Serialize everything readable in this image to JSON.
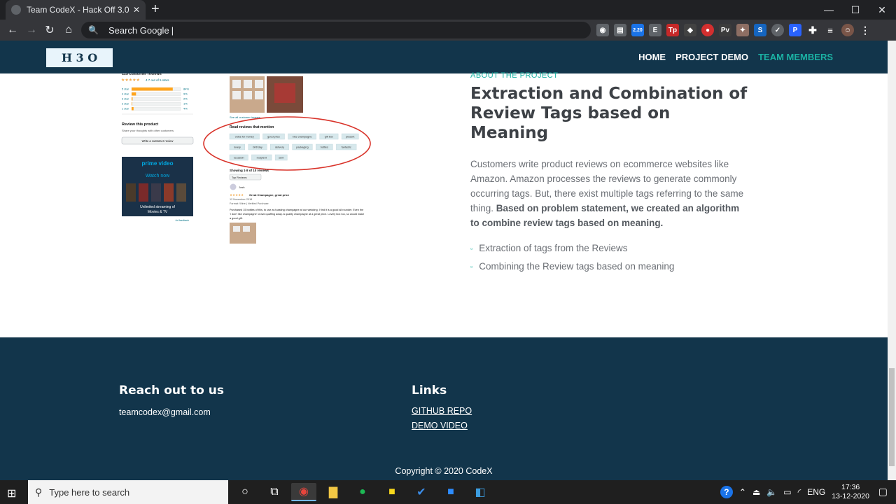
{
  "browser": {
    "tab_title": "Team CodeX - Hack Off 3.0",
    "omnibox_text": "Search Google",
    "badge_count": "2.20"
  },
  "site": {
    "logo_text": "H 3 O",
    "nav": [
      {
        "label": "HOME"
      },
      {
        "label": "PROJECT DEMO"
      },
      {
        "label": "TEAM MEMBERS"
      }
    ]
  },
  "about": {
    "kicker": "ABOUT THE PROJECT",
    "heading": "Extraction and Combination of Review Tags based on Meaning",
    "paragraph_plain": "Customers write product reviews on ecommerce websites like Amazon. Amazon processes the reviews to generate commonly occurring tags. But, there exist multiple tags referring to the same thing. ",
    "paragraph_bold": "Based on problem statement, we created an algorithm to combine review tags based on meaning.",
    "points": [
      "Extraction of tags from the Reviews",
      "Combining the Review tags based on meaning"
    ]
  },
  "screenshot": {
    "review_heading": "Review this product",
    "review_sub": "Share your thoughts with other customers",
    "write_review_btn": "Write a customer review",
    "prime_title": "prime video",
    "prime_cta": "Watch now",
    "prime_caption": "Unlimited streaming of Movies & TV",
    "tags_heading": "Read reviews that mention",
    "tags": [
      "value for money",
      "good price",
      "nice champagne",
      "gift box",
      "present",
      "lovely",
      "birthday",
      "delivery",
      "packaging",
      "bottles",
      "fantastic",
      "occasion",
      "recipient",
      "sent"
    ],
    "showing": "Showing 1-8 of 10 reviews",
    "sort": "Top Reviews",
    "reviewer": "Josh",
    "review_title": "Great Champagne, great price",
    "review_date": "12 November 2018",
    "review_meta": "Format: Wine | Verified Purchase",
    "review_text": "Purchased 15 bottles of this, to use as toasting champagne at our wedding. I find it is a good all rounder. Even the 'I don't like champagne' crowd quaffing away. A quality champagne at a great price. Lovely box too, so would make a good gift.",
    "ratings": [
      {
        "label": "5 star",
        "pct": "84%",
        "value": 0.84
      },
      {
        "label": "4 star",
        "pct": "9%",
        "value": 0.09
      },
      {
        "label": "3 star",
        "pct": "2%",
        "value": 0.02
      },
      {
        "label": "2 star",
        "pct": "1%",
        "value": 0.01
      },
      {
        "label": "1 star",
        "pct": "4%",
        "value": 0.04
      }
    ],
    "rating_summary": "4.7 out of 5 stars"
  },
  "footer": {
    "reach_heading": "Reach out to us",
    "email": "teamcodex@gmail.com",
    "links_heading": "Links",
    "links": [
      "GITHUB REPO",
      "DEMO VIDEO"
    ],
    "copyright": "Copyright © 2020 CodeX"
  },
  "taskbar": {
    "search_placeholder": "Type here to search",
    "lang": "ENG",
    "time": "17:36",
    "date": "13-12-2020"
  },
  "colors": {
    "header_bg": "#12354b",
    "accent": "#1bb1a3"
  }
}
